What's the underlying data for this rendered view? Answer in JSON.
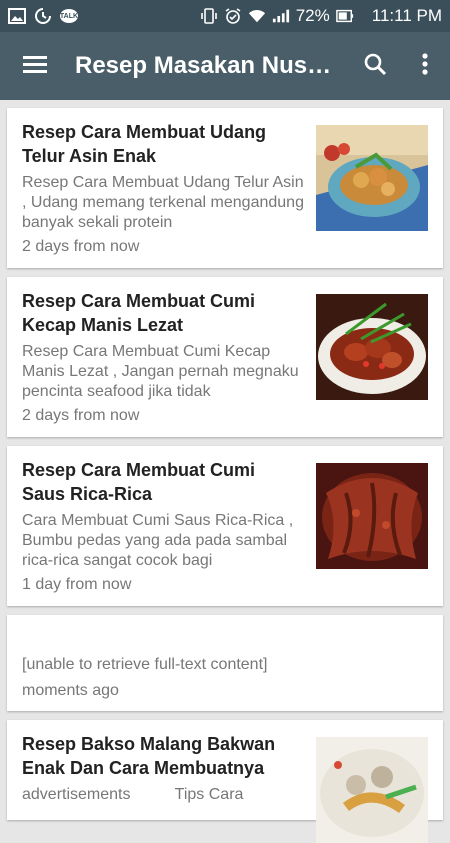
{
  "status_bar": {
    "left_icons": [
      "image-icon",
      "sync-icon",
      "talk-icon"
    ],
    "talk_label": "TALK",
    "battery_percent": "72%",
    "time": "11:11 PM"
  },
  "app_bar": {
    "title": "Resep Masakan Nusa...",
    "menu_icon": "hamburger-menu-icon",
    "search_icon": "search-icon",
    "more_icon": "more-vert-icon"
  },
  "feed": {
    "items": [
      {
        "title": "Resep Cara Membuat Udang Telur Asin Enak",
        "description": "Resep Cara Membuat Udang Telur Asin , Udang memang terkenal mengandung banyak sekali protein",
        "time": "2 days from now"
      },
      {
        "title": "Resep Cara Membuat Cumi Kecap Manis Lezat",
        "description": "Resep Cara Membuat Cumi Kecap Manis Lezat , Jangan pernah megnaku pencinta seafood jika tidak",
        "time": "2 days from now"
      },
      {
        "title": "Resep Cara Membuat Cumi Saus Rica-Rica",
        "description": "Cara Membuat Cumi Saus Rica-Rica , Bumbu pedas yang ada pada sambal rica-rica sangat cocok bagi",
        "time": "1 day from now"
      },
      {
        "title": "",
        "description": "[unable to retrieve full-text content]",
        "time": "moments ago"
      },
      {
        "title": "Resep Bakso Malang Bakwan Enak Dan Cara Membuatnya",
        "description": "advertisements          Tips Cara",
        "time": ""
      }
    ]
  }
}
